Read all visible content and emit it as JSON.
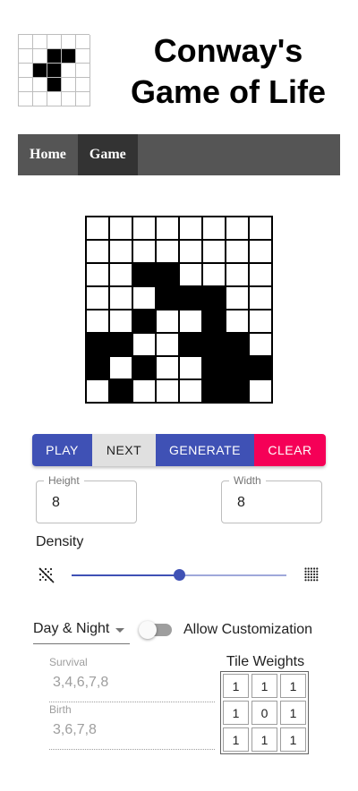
{
  "header": {
    "title_line1": "Conway's",
    "title_line2": "Game of Life",
    "logo_pattern": [
      [
        0,
        0,
        0,
        0,
        0
      ],
      [
        0,
        0,
        1,
        1,
        0
      ],
      [
        0,
        1,
        1,
        0,
        0
      ],
      [
        0,
        0,
        1,
        0,
        0
      ],
      [
        0,
        0,
        0,
        0,
        0
      ]
    ]
  },
  "nav": {
    "items": [
      {
        "label": "Home",
        "active": false
      },
      {
        "label": "Game",
        "active": true
      }
    ]
  },
  "board": {
    "rows": 8,
    "cols": 8,
    "cells": [
      [
        0,
        0,
        0,
        0,
        0,
        0,
        0,
        0
      ],
      [
        0,
        0,
        0,
        0,
        0,
        0,
        0,
        0
      ],
      [
        0,
        0,
        1,
        1,
        0,
        0,
        0,
        0
      ],
      [
        0,
        0,
        0,
        1,
        1,
        1,
        0,
        0
      ],
      [
        0,
        0,
        1,
        0,
        0,
        1,
        0,
        0
      ],
      [
        1,
        1,
        0,
        0,
        1,
        1,
        1,
        0
      ],
      [
        1,
        0,
        1,
        0,
        0,
        1,
        1,
        1
      ],
      [
        0,
        1,
        0,
        0,
        0,
        1,
        1,
        0
      ]
    ]
  },
  "controls": {
    "play_label": "PLAY",
    "next_label": "NEXT",
    "generate_label": "GENERATE",
    "clear_label": "CLEAR",
    "colors": {
      "primary": "#3f51b5",
      "secondary": "#f50057",
      "neutral": "#e0e0e0"
    }
  },
  "size": {
    "height_label": "Height",
    "height_value": "8",
    "width_label": "Width",
    "width_value": "8"
  },
  "density": {
    "label": "Density",
    "value": 0.5,
    "min_icon": "sparse-dots-icon",
    "max_icon": "dense-dots-icon"
  },
  "rules": {
    "selected": "Day & Night",
    "customize_label": "Allow Customization",
    "customize_enabled": false,
    "survival_label": "Survival",
    "survival_value": "3,4,6,7,8",
    "birth_label": "Birth",
    "birth_value": "3,6,7,8"
  },
  "tile_weights": {
    "title": "Tile Weights",
    "values": [
      [
        "1",
        "1",
        "1"
      ],
      [
        "1",
        "0",
        "1"
      ],
      [
        "1",
        "1",
        "1"
      ]
    ]
  }
}
